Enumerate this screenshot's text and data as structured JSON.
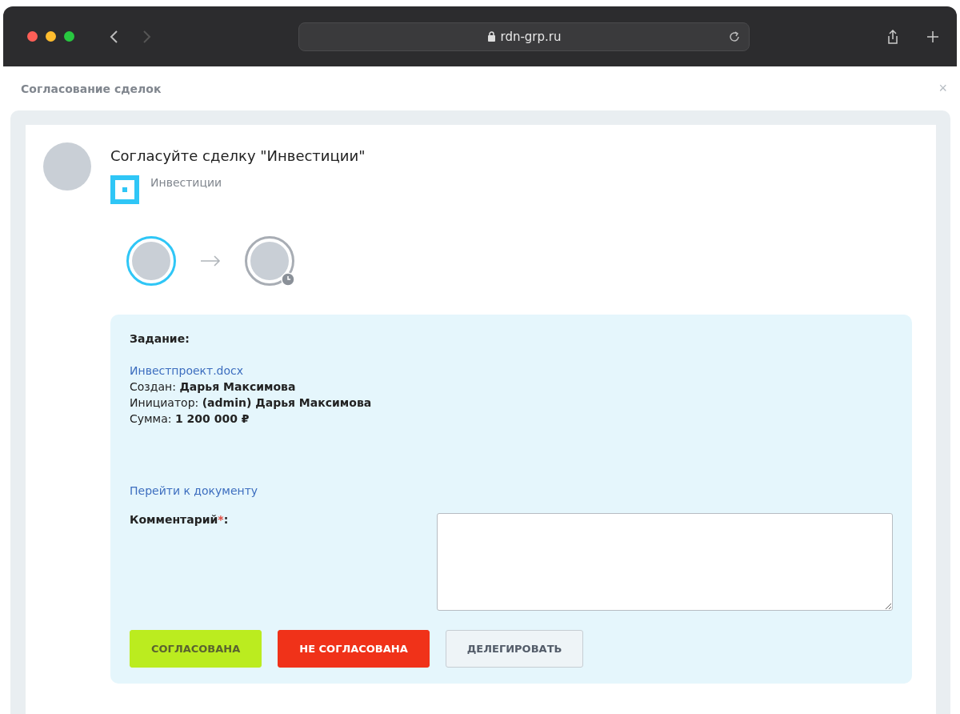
{
  "browser": {
    "url": "rdn-grp.ru"
  },
  "dialog": {
    "title": "Согласование сделок",
    "close": "×"
  },
  "task": {
    "title": "Согласуйте сделку \"Инвестиции\"",
    "entity": "Инвестиции"
  },
  "approvers": [
    {
      "kind": "done"
    },
    {
      "kind": "pending"
    }
  ],
  "details": {
    "heading": "Задание:",
    "file_link": "Инвестпроект.docx",
    "lines": [
      "Создан: **Дарья Максимова**",
      "Инициатор: **(admin) Дарья Максимова**",
      "Сумма: **1 200 000 ₽**"
    ],
    "document_link": "Перейти к документу"
  },
  "comment": {
    "label": "Комментарий",
    "required_mark": "*",
    "colon": ":"
  },
  "buttons": [
    {
      "kind": "approve",
      "label": "СОГЛАСОВАНА"
    },
    {
      "kind": "reject",
      "label": "НЕ СОГЛАСОВАНА"
    },
    {
      "kind": "neutral",
      "label": "ДЕЛЕГИРОВАТЬ"
    }
  ]
}
